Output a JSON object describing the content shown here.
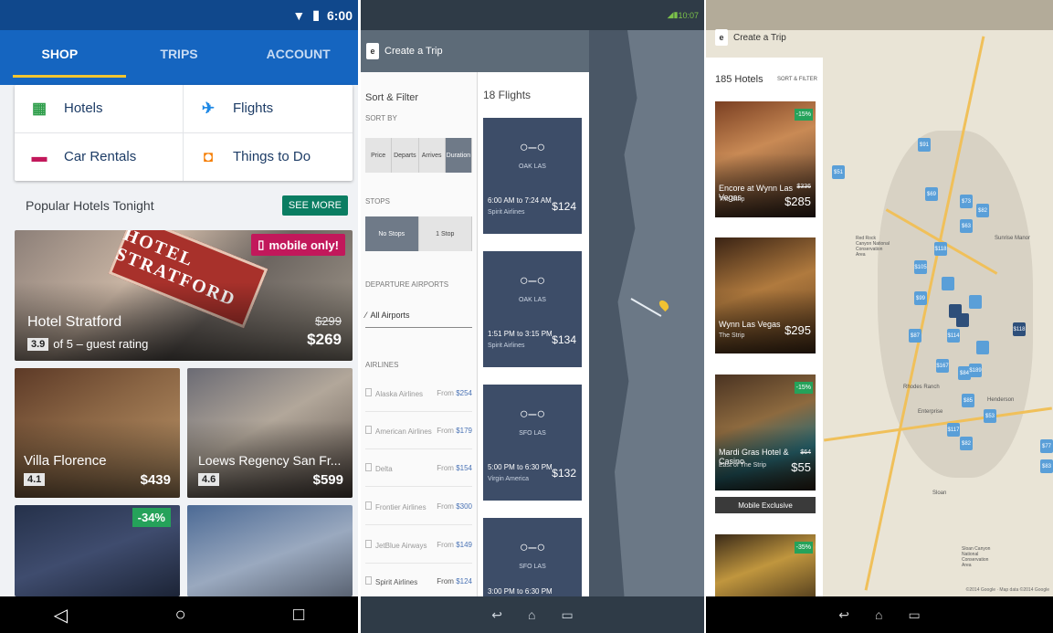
{
  "shop": {
    "status_time": "6:00",
    "tabs": [
      "SHOP",
      "TRIPS",
      "ACCOUNT"
    ],
    "lob": [
      {
        "label": "Hotels",
        "icon": "hotel-icon",
        "color": "#2e9e4a"
      },
      {
        "label": "Flights",
        "icon": "airplane-icon",
        "color": "#1e88e5"
      },
      {
        "label": "Car Rentals",
        "icon": "car-icon",
        "color": "#c2185b"
      },
      {
        "label": "Things to Do",
        "icon": "ticket-icon",
        "color": "#f57c00"
      }
    ],
    "popular_title": "Popular Hotels Tonight",
    "see_more": "SEE MORE",
    "featured": {
      "badge": "mobile only!",
      "sign": "HOTEL STRATFORD",
      "name": "Hotel Stratford",
      "rating": "3.9",
      "rating_text": "of 5 – guest rating",
      "old_price": "$299",
      "price": "$269"
    },
    "hotels": [
      {
        "name": "Villa Florence",
        "rating": "4.1",
        "price": "$439"
      },
      {
        "name": "Loews Regency San Fr...",
        "rating": "4.6",
        "price": "$599"
      },
      {
        "discount": "-34%"
      }
    ]
  },
  "flights": {
    "status_time": "10:07",
    "title": "Create a Trip",
    "sort_filter": "Sort & Filter",
    "sort_by": "SORT BY",
    "sort_options": [
      "Price",
      "Departs",
      "Arrives",
      "Duration"
    ],
    "stops": "STOPS",
    "stop_options": [
      "No Stops",
      "1 Stop"
    ],
    "departure_label": "DEPARTURE AIRPORTS",
    "departure_value": "All Airports",
    "airlines_label": "AIRLINES",
    "airlines": [
      {
        "name": "Alaska Airlines",
        "from": "From",
        "price": "$254"
      },
      {
        "name": "American Airlines",
        "from": "From",
        "price": "$179"
      },
      {
        "name": "Delta",
        "from": "From",
        "price": "$154"
      },
      {
        "name": "Frontier Airlines",
        "from": "From",
        "price": "$300"
      },
      {
        "name": "JetBlue Airways",
        "from": "From",
        "price": "$149"
      },
      {
        "name": "Spirit Airlines",
        "from": "From",
        "price": "$124"
      }
    ],
    "count": "18 Flights",
    "cards": [
      {
        "route": "OAK LAS",
        "time": "6:00 AM to 7:24 AM",
        "airline": "Spirit Airlines",
        "price": "$124"
      },
      {
        "route": "OAK LAS",
        "time": "1:51 PM to 3:15 PM",
        "airline": "Spirit Airlines",
        "price": "$134"
      },
      {
        "route": "SFO LAS",
        "time": "5:00 PM to 6:30 PM",
        "airline": "Virgin America",
        "price": "$132"
      },
      {
        "route": "SFO LAS",
        "time": "3:00 PM to 6:30 PM"
      }
    ]
  },
  "hotels_map": {
    "title": "Create a Trip",
    "count": "185 Hotels",
    "sort": "SORT & FILTER",
    "list": [
      {
        "name": "Encore at Wynn Las Vegas",
        "sub": "The Strip",
        "old_price": "$336",
        "price": "$285",
        "badge": "-15%"
      },
      {
        "name": "Wynn Las Vegas",
        "sub": "The Strip",
        "price": "$295"
      },
      {
        "name": "Mardi Gras Hotel & Casino",
        "sub": "East of The Strip",
        "old_price": "$64",
        "price": "$55",
        "badge": "-15%",
        "exclusive": "Mobile Exclusive"
      },
      {
        "badge": "-35%"
      }
    ],
    "map_labels": [
      "Red Rock Canyon National Conservation Area",
      "Rhodes Ranch",
      "Enterprise",
      "Henderson",
      "Sloan",
      "Sloan Canyon National Conservation Area",
      "Sunrise Manor"
    ],
    "pins": [
      "$91",
      "$51",
      "$69",
      "$73",
      "$82",
      "$63",
      "$118",
      "$105",
      "$99",
      "$87",
      "$114",
      "$167",
      "$84",
      "$189",
      "$85",
      "$117",
      "$82",
      "$53",
      "$118",
      "$77",
      "$83"
    ],
    "credit": "©2014 Google · Map data ©2014 Google"
  }
}
